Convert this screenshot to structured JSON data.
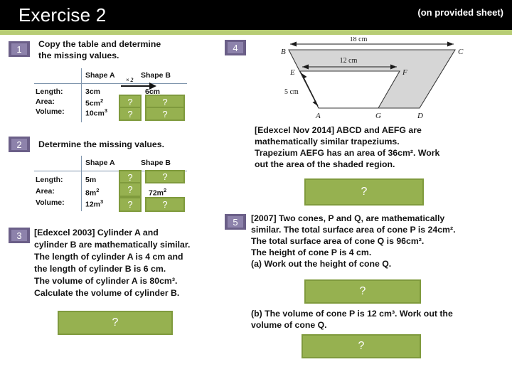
{
  "header": {
    "title": "Exercise 2",
    "note": "(on provided sheet)",
    "bar_color": "#b7cc74",
    "bg_color": "#000000"
  },
  "theme": {
    "badge_outer": "#6b5f88",
    "badge_inner": "#8d82ab",
    "answer_fill": "#96b150",
    "answer_border": "#7f9a3d",
    "table_rule": "#7f95ad",
    "text": "#141414"
  },
  "exercises": [
    {
      "number": "1",
      "prompt_line1": "Copy the table and determine",
      "prompt_line2": "the missing values.",
      "table": {
        "col_headers": [
          "Shape A",
          "Shape B"
        ],
        "row_labels": [
          "Length:",
          "Area:",
          "Volume:"
        ],
        "shape_a": [
          "3cm",
          "5cm",
          "10cm"
        ],
        "shape_a_sup": [
          "",
          "2",
          "3"
        ],
        "shape_b": [
          "6cm",
          "?",
          "?"
        ],
        "hidden_a": [
          "",
          "?",
          "?"
        ],
        "scale_label": "× 2"
      }
    },
    {
      "number": "2",
      "prompt_line1": "Determine the missing values.",
      "table": {
        "col_headers": [
          "Shape A",
          "Shape B"
        ],
        "row_labels": [
          "Length:",
          "Area:",
          "Volume:"
        ],
        "shape_a": [
          "5m",
          "8m",
          "12m"
        ],
        "shape_a_sup": [
          "",
          "2",
          "3"
        ],
        "shape_b": [
          "?",
          "72m",
          "?"
        ],
        "shape_b_sup": [
          "",
          "2",
          ""
        ],
        "hidden_a": [
          "?",
          "?",
          "?"
        ]
      }
    },
    {
      "number": "3",
      "lines": [
        "[Edexcel 2003] Cylinder A and",
        "cylinder B are mathematically similar.",
        "The length of cylinder A is 4 cm and",
        "the length of cylinder B is 6 cm.",
        "The volume of cylinder A is 80cm³.",
        "Calculate the volume of cylinder B."
      ],
      "answer": "?"
    },
    {
      "number": "4",
      "lines": [
        "[Edexcel Nov 2014] ABCD and AEFG are",
        "mathematically similar trapeziums.",
        "Trapezium AEFG has an area of 36cm². Work",
        "out the area of the shaded region."
      ],
      "answer": "?",
      "diagram": {
        "vertex_labels": [
          "B",
          "C",
          "E",
          "F",
          "A",
          "G",
          "D"
        ],
        "dim_top": "18 cm",
        "dim_mid": "12 cm",
        "dim_side": "5 cm",
        "fill": "#d6d6d6",
        "stroke": "#3a3a3a"
      }
    },
    {
      "number": "5",
      "lines": [
        "[2007] Two cones, P and Q, are mathematically",
        "similar. The total surface area of cone P is 24cm².",
        "The total surface area of cone Q is 96cm².",
        "The height of cone P is 4 cm.",
        "(a) Work out the height of cone Q."
      ],
      "answer_a": "?",
      "part_b_lines": [
        "(b) The volume of cone P is 12 cm³. Work out the",
        "volume of cone Q."
      ],
      "answer_b": "?"
    }
  ]
}
